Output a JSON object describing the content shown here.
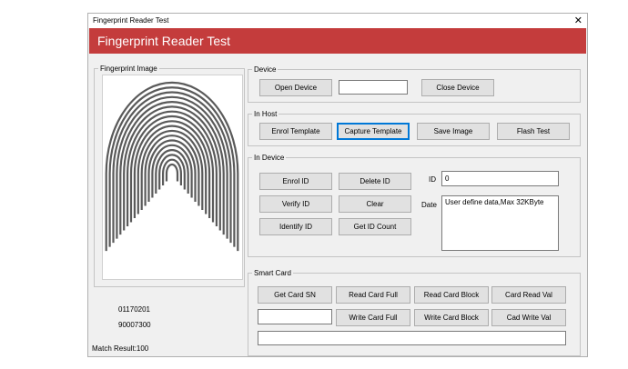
{
  "window": {
    "title": "Fingerprint Reader Test",
    "close_glyph": "✕",
    "banner_title": "Fingerprint Reader Test"
  },
  "fingerprint": {
    "group_label": "Fingerprint Image",
    "value1": "01170201",
    "value2": "90007300",
    "match_result": "Match Result:100"
  },
  "device": {
    "group_label": "Device",
    "open_label": "Open Device",
    "close_label": "Close Device",
    "status_value": ""
  },
  "in_host": {
    "group_label": "In Host",
    "enrol_label": "Enrol Template",
    "capture_label": "Capture Template",
    "save_label": "Save Image",
    "flash_label": "Flash Test"
  },
  "in_device": {
    "group_label": "In Device",
    "enrol_id_label": "Enrol ID",
    "delete_id_label": "Delete ID",
    "verify_id_label": "Verify ID",
    "clear_label": "Clear",
    "identify_id_label": "Identify ID",
    "get_id_count_label": "Get ID Count",
    "id_label": "ID",
    "id_value": "0",
    "date_label": "Date",
    "data_value": "User define data,Max 32KByte"
  },
  "smart_card": {
    "group_label": "Smart Card",
    "get_sn_label": "Get Card SN",
    "read_full_label": "Read Card Full",
    "read_block_label": "Read Card Block",
    "read_val_label": "Card Read Val",
    "write_full_label": "Write Card Full",
    "write_block_label": "Write Card Block",
    "write_val_label": "Cad Write Val",
    "sn_value": "",
    "output_value": ""
  },
  "colors": {
    "banner": "#c43c3c",
    "focus": "#0078d7"
  }
}
